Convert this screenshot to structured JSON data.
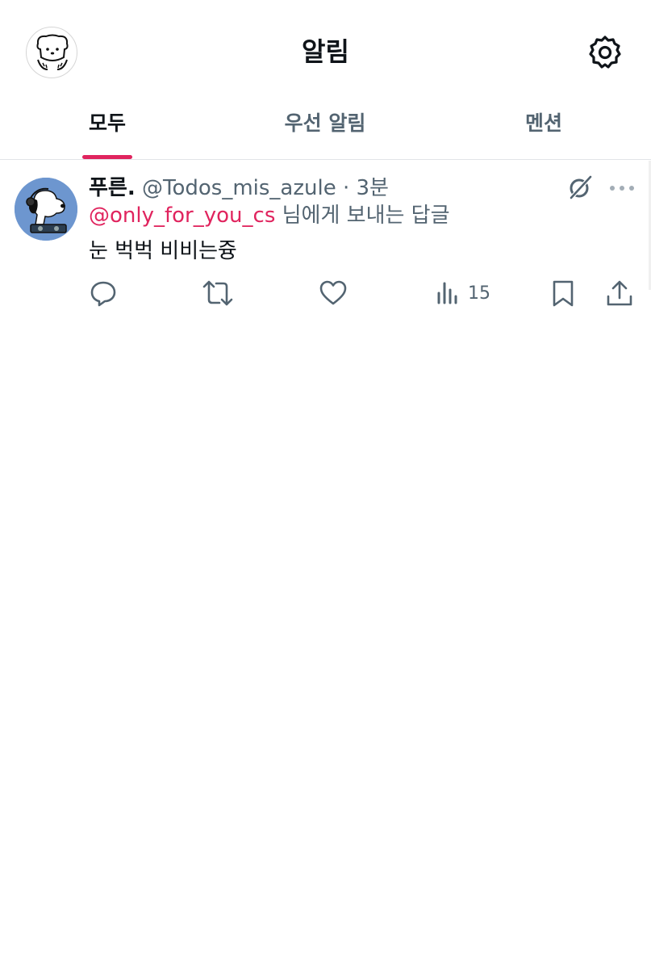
{
  "header": {
    "title": "알림",
    "avatar_icon": "dog-avatar-icon",
    "settings_icon": "gear-icon"
  },
  "tabs": [
    {
      "label": "모두",
      "active": true
    },
    {
      "label": "우선 알림",
      "active": false
    },
    {
      "label": "멘션",
      "active": false
    }
  ],
  "notification": {
    "author": "푸른.",
    "handle": "@Todos_mis_azule",
    "separator": "·",
    "time": "3분",
    "reply_to_mention": "@only_for_you_cs",
    "reply_to_suffix": "님에게 보내는 답글",
    "text": "눈 벅벅 비비는즁",
    "views": "15",
    "icons": [
      "reply-icon",
      "retweet-icon",
      "like-icon",
      "views-icon",
      "bookmark-icon",
      "share-icon",
      "grok-icon",
      "more-icon"
    ]
  },
  "colors": {
    "accent": "#e0245e",
    "muted_text": "#536471",
    "primary_text": "#0f1419",
    "avatar_bg": "#6d96cf"
  }
}
